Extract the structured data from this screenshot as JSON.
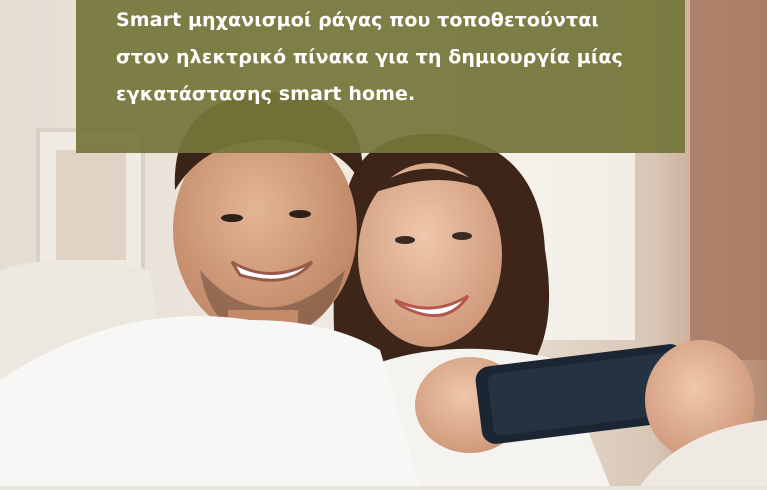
{
  "banner": {
    "caption_line1": "Smart μηχανισμοί ράγας που τοποθετούνται",
    "caption_line2": "στον ηλεκτρικό πίνακα για τη δημιουργία μίας",
    "caption_line3": "εγκατάστασης smart home."
  },
  "photo": {
    "subject": "couple-looking-at-smartphone",
    "colors": {
      "overlay": "#74763a",
      "caption_text": "#ffffff",
      "wall": "#e9e4dc",
      "shirt": "#f7f7f5",
      "hair_dark": "#3a2418",
      "phone": "#1c2633"
    }
  }
}
